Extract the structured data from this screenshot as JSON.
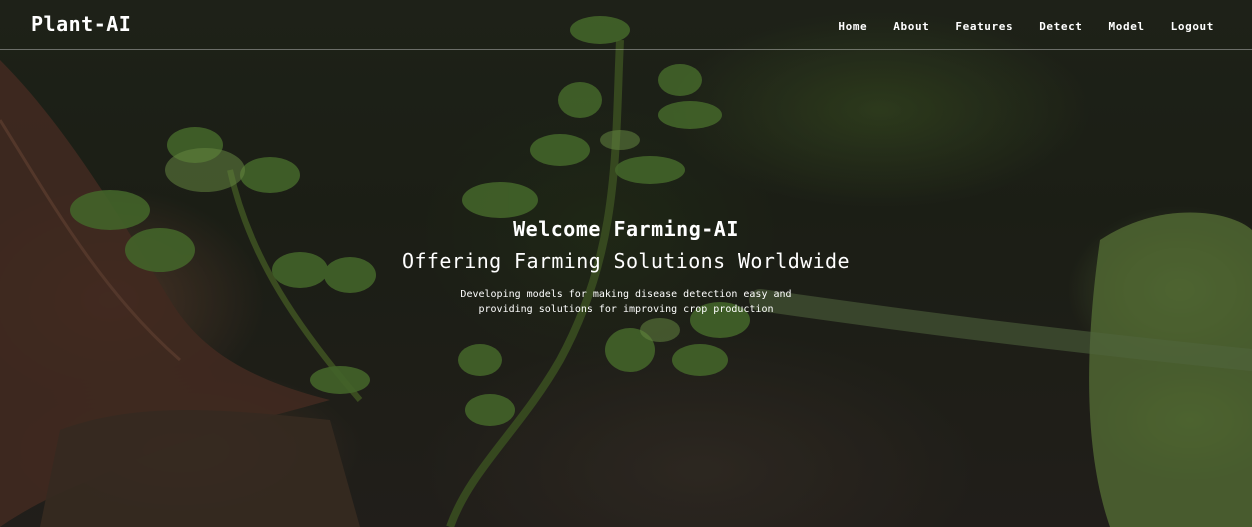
{
  "navbar": {
    "brand": "Plant-AI",
    "links": [
      "Home",
      "About",
      "Features",
      "Detect",
      "Model",
      "Logout"
    ]
  },
  "hero": {
    "welcome": "Welcome Farming-AI",
    "tagline": "Offering Farming Solutions Worldwide",
    "description": "Developing models for making disease detection easy and providing solutions for improving crop production"
  },
  "colors": {
    "text": "#ffffff",
    "overlay": "rgba(0,0,0,0.28)"
  }
}
